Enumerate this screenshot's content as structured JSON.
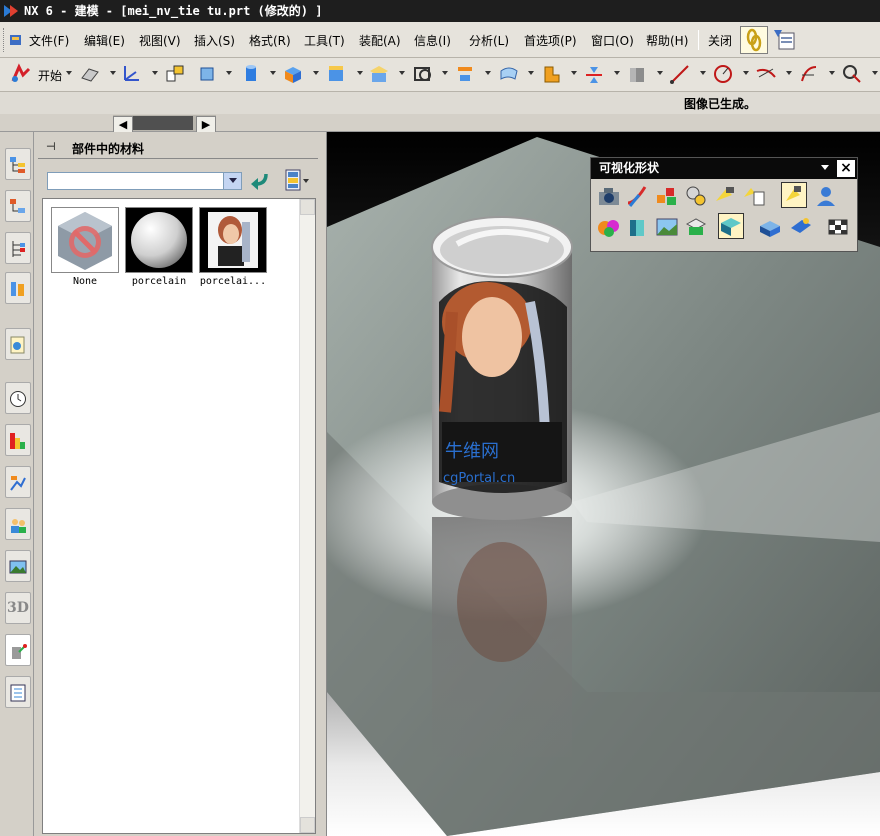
{
  "window": {
    "title": "NX 6 - 建模 - [mei_nv_tie tu.prt (修改的) ]"
  },
  "menu": {
    "items": [
      "文件(F)",
      "编辑(E)",
      "视图(V)",
      "插入(S)",
      "格式(R)",
      "工具(T)",
      "装配(A)",
      "信息(I)",
      "分析(L)",
      "首选项(P)",
      "窗口(O)",
      "帮助(H)"
    ],
    "close_label": "关闭"
  },
  "toolbar": {
    "start_label": "开始"
  },
  "status": {
    "message": "图像已生成。"
  },
  "panel": {
    "title": "部件中的材料",
    "search_value": "",
    "materials": [
      {
        "label": "None",
        "icon": "none-material-icon"
      },
      {
        "label": "porcelain",
        "icon": "porcelain-sphere-icon"
      },
      {
        "label": "porcelai...",
        "icon": "photo-texture-thumbnail"
      }
    ]
  },
  "visual_toolbar": {
    "title": "可视化形状"
  },
  "viewport": {
    "texture_text_1": "牛维网",
    "texture_text_2": "cgPortal.cn"
  },
  "colors": {
    "titlebar": "#1e1e1e",
    "menubar": "#e6e3dc",
    "panel": "#d4d0c8",
    "selected_icon_bg": "#fff4c4"
  }
}
